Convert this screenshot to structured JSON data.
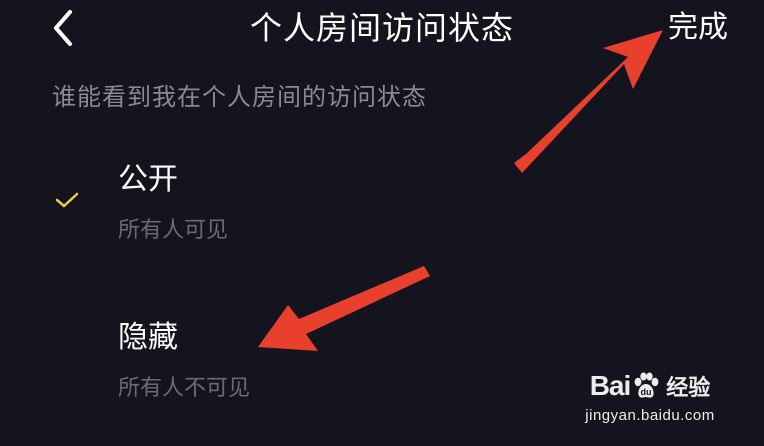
{
  "header": {
    "title": "个人房间访问状态",
    "done_label": "完成",
    "back_icon": "chevron-left-icon"
  },
  "description": "谁能看到我在个人房间的访问状态",
  "options": [
    {
      "title": "公开",
      "subtitle": "所有人可见",
      "selected": true
    },
    {
      "title": "隐藏",
      "subtitle": "所有人不可见",
      "selected": false
    }
  ],
  "colors": {
    "background": "#14141e",
    "primary_text": "#ffffff",
    "secondary_text": "#8a8a93",
    "check_accent": "#f2c94c",
    "annotation_arrow": "#e8402d"
  },
  "watermark": {
    "brand_left": "Bai",
    "brand_right": "经验",
    "url": "jingyan.baidu.com"
  }
}
